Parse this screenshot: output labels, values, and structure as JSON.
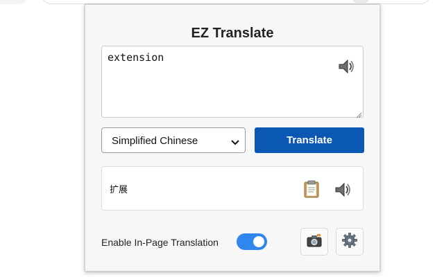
{
  "popup": {
    "title": "EZ Translate",
    "source_text": "extension",
    "target_language": "Simplified Chinese",
    "translate_label": "Translate",
    "result_text": "扩展",
    "toggle_label": "Enable In-Page Translation",
    "toggle_on": true
  },
  "colors": {
    "translate_button": "#0b57b4",
    "toggle_on": "#2f86ee"
  },
  "icons": {
    "source_speaker": "speaker-icon",
    "result_speaker": "speaker-icon",
    "copy": "clipboard-icon",
    "camera": "camera-icon",
    "settings": "gear-icon"
  }
}
